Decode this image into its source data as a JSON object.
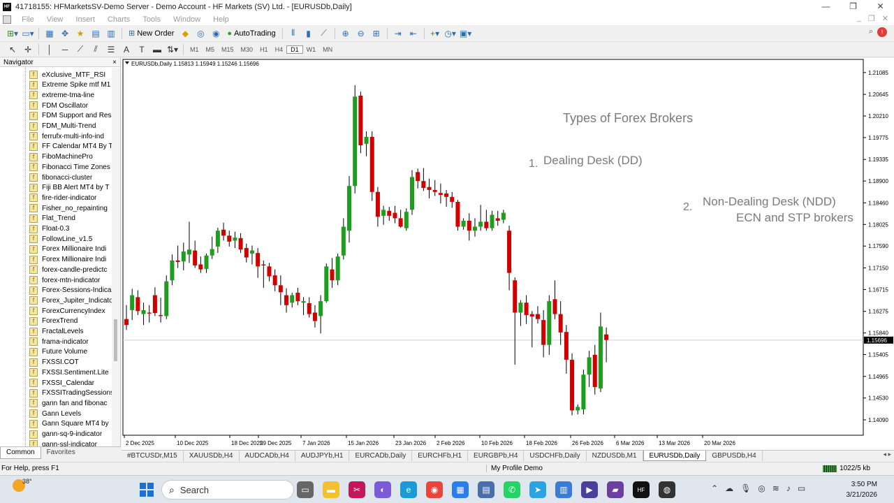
{
  "window": {
    "title": "41718155: HFMarketsSV-Demo Server - Demo Account - HF Markets (SV) Ltd. - [EURUSDb,Daily]",
    "app_icon": "HF",
    "controls": [
      "minimize-icon",
      "restore-icon",
      "close-icon"
    ]
  },
  "menubar": {
    "items": [
      "File",
      "View",
      "Insert",
      "Charts",
      "Tools",
      "Window",
      "Help"
    ]
  },
  "toolbar": {
    "new_order_label": "New Order",
    "autotrading_label": "AutoTrading",
    "timeframes": [
      "M1",
      "M5",
      "M15",
      "M30",
      "H1",
      "H4",
      "D1",
      "W1",
      "MN"
    ],
    "active_timeframe": "D1"
  },
  "navigator": {
    "title": "Navigator",
    "close_label": "×",
    "items": [
      "eXclusive_MTF_RSI",
      "Extreme Spike mtf M1",
      "extreme-tma-line",
      "FDM Oscillator",
      "FDM Support and Res",
      "FDM_Multi-Trend",
      "ferrufx-multi-info-ind",
      "FF Calendar MT4 By T",
      "FiboMachinePro",
      "Fibonacci Time Zones",
      "fibonacci-cluster",
      "Fiji BB Alert MT4 by T",
      "fire-rider-indicator",
      "Fisher_no_repainting",
      "Flat_Trend",
      "Float-0.3",
      "FollowLine_v1.5",
      "Forex Millionaire Indi",
      "Forex Millionaire Indi",
      "forex-candle-predictc",
      "forex-mtn-indicator",
      "Forex-Sessions-Indica",
      "Forex_Jupiter_Indicato",
      "ForexCurrencyIndex",
      "ForexTrend",
      "FractalLevels",
      "frama-indicator",
      "Future Volume",
      "FXSSI.COT",
      "FXSSI.Sentiment.Lite",
      "FXSSI_Calendar",
      "FXSSITradingSessions",
      "gann fan and fibonac",
      "Gann Levels",
      "Gann Square MT4 by",
      "gann-sq-9-indicator",
      "gann-ssl-indicator"
    ],
    "tabs": [
      "Common",
      "Favorites"
    ],
    "active_tab": "Common"
  },
  "chart": {
    "header": "EURUSDb,Daily  1.15813 1.15949 1.15246 1.15696",
    "current_price_label": "1.15696",
    "annotations": {
      "title": "Types of Forex Brokers",
      "item1_num": "1.",
      "item1_text": "Dealing Desk (DD)",
      "item2_num": "2.",
      "item2_text": "Non-Dealing Desk (NDD)",
      "item2_sub": "ECN and STP brokers"
    },
    "colors": {
      "bull": "#1f9d1f",
      "bear": "#d10000",
      "grid": "#e8e8e8",
      "bg": "#ffffff"
    }
  },
  "chart_data": {
    "type": "candlestick",
    "symbol": "EURUSDb",
    "timeframe": "Daily",
    "ohlc_header": [
      1.15813,
      1.15949,
      1.15246,
      1.15696
    ],
    "current_price": 1.15696,
    "ylim": [
      1.1378,
      1.2135
    ],
    "y_ticks": [
      "1.21085",
      "1.20645",
      "1.20210",
      "1.19775",
      "1.19335",
      "1.18900",
      "1.18460",
      "1.18025",
      "1.17590",
      "1.17150",
      "1.16715",
      "1.16275",
      "1.15840",
      "1.15405",
      "1.14965",
      "1.14530",
      "1.14090"
    ],
    "x_ticks": [
      "2 Dec 2025",
      "10 Dec 2025",
      "18 Dec 2025",
      "29 Dec 2025",
      "7 Jan 2026",
      "15 Jan 2026",
      "23 Jan 2026",
      "2 Feb 2026",
      "10 Feb 2026",
      "18 Feb 2026",
      "26 Feb 2026",
      "6 Mar 2026",
      "13 Mar 2026",
      "20 Mar 2026"
    ],
    "candles": [
      [
        1.1612,
        1.164,
        1.159,
        1.16
      ],
      [
        1.163,
        1.1673,
        1.161,
        1.166
      ],
      [
        1.1656,
        1.167,
        1.162,
        1.1628
      ],
      [
        1.1622,
        1.1645,
        1.16,
        1.163
      ],
      [
        1.1625,
        1.164,
        1.1605,
        1.1623
      ],
      [
        1.166,
        1.1676,
        1.1618,
        1.1624
      ],
      [
        1.162,
        1.1655,
        1.1605,
        1.1618
      ],
      [
        1.1618,
        1.17,
        1.1612,
        1.1688
      ],
      [
        1.169,
        1.1742,
        1.168,
        1.173
      ],
      [
        1.173,
        1.176,
        1.1715,
        1.1727
      ],
      [
        1.1728,
        1.1766,
        1.171,
        1.1748
      ],
      [
        1.1742,
        1.1808,
        1.1725,
        1.1752
      ],
      [
        1.175,
        1.177,
        1.1715,
        1.172
      ],
      [
        1.1722,
        1.1738,
        1.1705,
        1.1712
      ],
      [
        1.1713,
        1.1744,
        1.1705,
        1.174
      ],
      [
        1.174,
        1.1778,
        1.1733,
        1.1753
      ],
      [
        1.1758,
        1.1796,
        1.1745,
        1.179
      ],
      [
        1.1792,
        1.1806,
        1.177,
        1.178
      ],
      [
        1.178,
        1.179,
        1.1758,
        1.1768
      ],
      [
        1.177,
        1.1788,
        1.1755,
        1.1776
      ],
      [
        1.1775,
        1.1785,
        1.1745,
        1.1752
      ],
      [
        1.1755,
        1.1764,
        1.1726,
        1.1736
      ],
      [
        1.1744,
        1.176,
        1.1722,
        1.175
      ],
      [
        1.1745,
        1.1755,
        1.1695,
        1.1718
      ],
      [
        1.1722,
        1.173,
        1.1675,
        1.172
      ],
      [
        1.1718,
        1.1725,
        1.1688,
        1.1698
      ],
      [
        1.17,
        1.1712,
        1.1668,
        1.168
      ],
      [
        1.168,
        1.17,
        1.164,
        1.1666
      ],
      [
        1.166,
        1.1674,
        1.1625,
        1.164
      ],
      [
        1.1645,
        1.1665,
        1.1635,
        1.166
      ],
      [
        1.1665,
        1.1675,
        1.164,
        1.1648
      ],
      [
        1.1645,
        1.1656,
        1.162,
        1.1648
      ],
      [
        1.1644,
        1.1656,
        1.1615,
        1.1622
      ],
      [
        1.1625,
        1.164,
        1.1595,
        1.1608
      ],
      [
        1.1618,
        1.166,
        1.1583,
        1.1648
      ],
      [
        1.1648,
        1.1724,
        1.1645,
        1.1718
      ],
      [
        1.1712,
        1.1735,
        1.1675,
        1.169
      ],
      [
        1.169,
        1.1744,
        1.168,
        1.1738
      ],
      [
        1.174,
        1.1815,
        1.1732,
        1.1798
      ],
      [
        1.179,
        1.19,
        1.1766,
        1.188
      ],
      [
        1.188,
        1.2083,
        1.1865,
        1.206
      ],
      [
        1.2062,
        1.207,
        1.1946,
        1.1962
      ],
      [
        1.1965,
        1.199,
        1.194,
        1.1979
      ],
      [
        1.1979,
        1.199,
        1.185,
        1.1868
      ],
      [
        1.1868,
        1.1878,
        1.1798,
        1.1818
      ],
      [
        1.182,
        1.184,
        1.1802,
        1.1832
      ],
      [
        1.183,
        1.1838,
        1.181,
        1.182
      ],
      [
        1.1826,
        1.184,
        1.1805,
        1.1815
      ],
      [
        1.1815,
        1.1832,
        1.1796,
        1.1798
      ],
      [
        1.1795,
        1.1835,
        1.179,
        1.1828
      ],
      [
        1.1832,
        1.1912,
        1.1822,
        1.1898
      ],
      [
        1.1908,
        1.1915,
        1.1875,
        1.189
      ],
      [
        1.189,
        1.1916,
        1.187,
        1.1876
      ],
      [
        1.1878,
        1.1895,
        1.1855,
        1.1872
      ],
      [
        1.1872,
        1.1892,
        1.186,
        1.1868
      ],
      [
        1.1866,
        1.1885,
        1.1845,
        1.1862
      ],
      [
        1.1865,
        1.1872,
        1.1838,
        1.1858
      ],
      [
        1.1858,
        1.1868,
        1.1836,
        1.1848
      ],
      [
        1.1848,
        1.1852,
        1.179,
        1.1798
      ],
      [
        1.1798,
        1.1815,
        1.1792,
        1.181
      ],
      [
        1.181,
        1.1825,
        1.177,
        1.179
      ],
      [
        1.179,
        1.1815,
        1.1778,
        1.1798
      ],
      [
        1.1798,
        1.1842,
        1.179,
        1.1808
      ],
      [
        1.1808,
        1.1832,
        1.179,
        1.1795
      ],
      [
        1.1795,
        1.183,
        1.179,
        1.1822
      ],
      [
        1.1815,
        1.183,
        1.18,
        1.181
      ],
      [
        1.1812,
        1.1832,
        1.1805,
        1.1826
      ],
      [
        1.179,
        1.18,
        1.167,
        1.1705
      ],
      [
        1.169,
        1.1696,
        1.152,
        1.1625
      ],
      [
        1.1625,
        1.165,
        1.1598,
        1.1645
      ],
      [
        1.1645,
        1.166,
        1.1602,
        1.162
      ],
      [
        1.1622,
        1.1628,
        1.1555,
        1.1617
      ],
      [
        1.1622,
        1.1638,
        1.1603,
        1.1612
      ],
      [
        1.161,
        1.163,
        1.1535,
        1.156
      ],
      [
        1.156,
        1.166,
        1.154,
        1.1648
      ],
      [
        1.1652,
        1.169,
        1.1612,
        1.1622
      ],
      [
        1.1622,
        1.1648,
        1.156,
        1.1585
      ],
      [
        1.1586,
        1.16,
        1.1502,
        1.153
      ],
      [
        1.153,
        1.1543,
        1.1418,
        1.1428
      ],
      [
        1.1428,
        1.144,
        1.142,
        1.1435
      ],
      [
        1.143,
        1.151,
        1.142,
        1.15
      ],
      [
        1.15,
        1.1548,
        1.1475,
        1.1535
      ],
      [
        1.154,
        1.156,
        1.146,
        1.1475
      ],
      [
        1.1472,
        1.1625,
        1.1465,
        1.1597
      ],
      [
        1.1581,
        1.1595,
        1.1525,
        1.157
      ]
    ]
  },
  "chart_tabs": {
    "items": [
      "#BTCUSDr,M15",
      "XAUUSDb,H4",
      "AUDCADb,H4",
      "AUDJPYb,H1",
      "EURCADb,Daily",
      "EURCHFb,H1",
      "EURGBPb,H4",
      "USDCHFb,Daily",
      "NZDUSDb,M1",
      "EURUSDb,Daily",
      "GBPUSDb,H4"
    ],
    "active": "EURUSDb,Daily"
  },
  "statusbar": {
    "help": "For Help, press F1",
    "profile": "My Profile Demo",
    "traffic": "1022/5 kb"
  },
  "taskbar": {
    "temperature": "38°",
    "search_label": "Search",
    "time": "3:50 PM",
    "date": "3/21/2026"
  }
}
